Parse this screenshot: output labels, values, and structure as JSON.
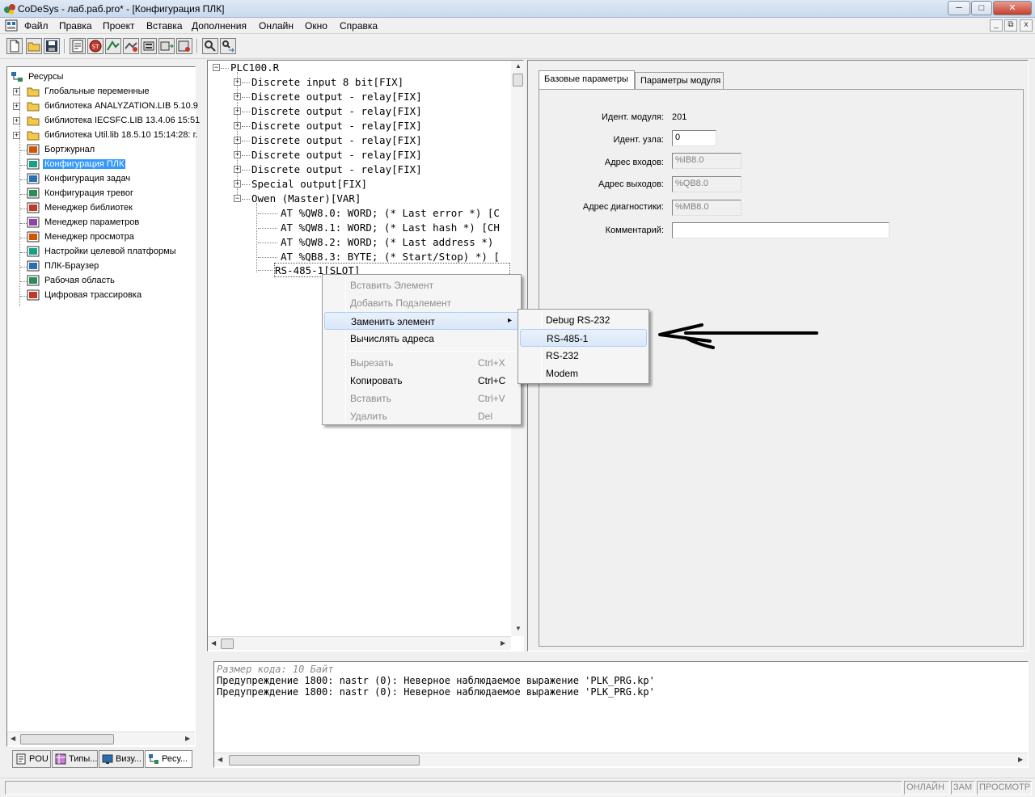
{
  "window": {
    "title": "CoDeSys - лаб.раб.pro* - [Конфигурация ПЛК]",
    "minimize": "─",
    "maximize": "□",
    "close": "✕"
  },
  "menu": {
    "items": [
      "Файл",
      "Правка",
      "Проект",
      "Вставка",
      "Дополнения",
      "Онлайн",
      "Окно",
      "Справка"
    ],
    "mdi_min": "_",
    "mdi_restore": "⧉",
    "mdi_close": "x"
  },
  "toolbar": {
    "icons": [
      "new-file-icon",
      "open-folder-icon",
      "save-icon",
      "compile-icon",
      "stop-icon",
      "login-icon",
      "logout-icon",
      "run-icon",
      "step-icon",
      "breakpoint-icon",
      "find-icon",
      "replace-icon"
    ]
  },
  "resources": {
    "root": "Ресурсы",
    "items": [
      {
        "label": "Глобальные переменные",
        "icon": "folder-icon",
        "expandable": true
      },
      {
        "label": "библиотека ANALYZATION.LIB 5.10.9",
        "icon": "folder-icon",
        "expandable": true
      },
      {
        "label": "библиотека IECSFC.LIB 13.4.06 15:51",
        "icon": "folder-icon",
        "expandable": true
      },
      {
        "label": "библиотека Util.lib 18.5.10 15:14:28: г.",
        "icon": "folder-icon",
        "expandable": true
      },
      {
        "label": "Бортжурнал",
        "icon": "logbook-icon",
        "expandable": false
      },
      {
        "label": "Конфигурация ПЛК",
        "icon": "plc-config-icon",
        "expandable": false,
        "selected": true
      },
      {
        "label": "Конфигурация задач",
        "icon": "task-config-icon",
        "expandable": false
      },
      {
        "label": "Конфигурация тревог",
        "icon": "alarm-config-icon",
        "expandable": false
      },
      {
        "label": "Менеджер библиотек",
        "icon": "library-manager-icon",
        "expandable": false
      },
      {
        "label": "Менеджер параметров",
        "icon": "parameter-manager-icon",
        "expandable": false
      },
      {
        "label": "Менеджер просмотра",
        "icon": "watch-manager-icon",
        "expandable": false
      },
      {
        "label": "Настройки целевой платформы",
        "icon": "target-settings-icon",
        "expandable": false
      },
      {
        "label": "ПЛК-Браузер",
        "icon": "plc-browser-icon",
        "expandable": false
      },
      {
        "label": "Рабочая область",
        "icon": "workspace-icon",
        "expandable": false
      },
      {
        "label": "Цифровая трассировка",
        "icon": "trace-icon",
        "expandable": false
      }
    ]
  },
  "bottom_tabs": [
    {
      "label": "POU",
      "icon": "pou-icon"
    },
    {
      "label": "Типы...",
      "icon": "types-icon"
    },
    {
      "label": "Визу...",
      "icon": "visualization-icon"
    },
    {
      "label": "Ресу...",
      "icon": "resources-icon"
    }
  ],
  "config_tree": {
    "root": "PLC100.R",
    "nodes": [
      {
        "text": "Discrete input 8 bit[FIX]",
        "sign": "+"
      },
      {
        "text": "Discrete output - relay[FIX]",
        "sign": "+"
      },
      {
        "text": "Discrete output - relay[FIX]",
        "sign": "+"
      },
      {
        "text": "Discrete output - relay[FIX]",
        "sign": "+"
      },
      {
        "text": "Discrete output - relay[FIX]",
        "sign": "+"
      },
      {
        "text": "Discrete output - relay[FIX]",
        "sign": "+"
      },
      {
        "text": "Discrete output - relay[FIX]",
        "sign": "+"
      },
      {
        "text": "Special output[FIX]",
        "sign": "+"
      },
      {
        "text": "Owen (Master)[VAR]",
        "sign": "−"
      }
    ],
    "children": [
      "AT %QW8.0: WORD; (* Last error *) [C",
      "AT %QW8.1: WORD; (* Last hash *) [CH",
      "AT %QW8.2: WORD; (* Last address *)",
      "AT %QB8.3: BYTE; (* Start/Stop) *) ["
    ],
    "slot": "RS-485-1[SLOT]"
  },
  "props": {
    "tabs": [
      "Базовые параметры",
      "Параметры модуля"
    ],
    "module_id_label": "Идент. модуля:",
    "module_id_value": "201",
    "node_id_label": "Идент. узла:",
    "node_id_value": "0",
    "input_addr_label": "Адрес входов:",
    "input_addr_value": "%IB8.0",
    "output_addr_label": "Адрес выходов:",
    "output_addr_value": "%QB8.0",
    "diag_addr_label": "Адрес диагностики:",
    "diag_addr_value": "%MB8.0",
    "comment_label": "Комментарий:",
    "comment_value": ""
  },
  "messages": [
    {
      "text": "Размер кода: 10 Байт",
      "dim": true
    },
    {
      "text": "Предупреждение 1800: nastr (0): Неверное наблюдаемое выражение 'PLK_PRG.kp'",
      "dim": false
    },
    {
      "text": "Предупреждение 1800: nastr (0): Неверное наблюдаемое выражение 'PLK_PRG.kp'",
      "dim": false
    }
  ],
  "status": [
    "ОНЛАЙН",
    "ЗАМ",
    "ПРОСМОТР"
  ],
  "context_menu": {
    "items": [
      {
        "label": "Вставить Элемент",
        "shortcut": "",
        "disabled": true
      },
      {
        "label": "Добавить Подэлемент",
        "shortcut": "",
        "disabled": true
      },
      {
        "label": "Заменить элемент",
        "shortcut": "",
        "disabled": false,
        "submenu": true,
        "highlighted": true
      },
      {
        "label": "Вычислять адреса",
        "shortcut": "",
        "disabled": false
      },
      {
        "separator": true
      },
      {
        "label": "Вырезать",
        "shortcut": "Ctrl+X",
        "disabled": true
      },
      {
        "label": "Копировать",
        "shortcut": "Ctrl+C",
        "disabled": false
      },
      {
        "label": "Вставить",
        "shortcut": "Ctrl+V",
        "disabled": true
      },
      {
        "label": "Удалить",
        "shortcut": "Del",
        "disabled": true
      }
    ],
    "submenu_arrow": "▸"
  },
  "submenu": {
    "items": [
      {
        "label": "Debug RS-232",
        "highlighted": false
      },
      {
        "label": "RS-485-1",
        "highlighted": true
      },
      {
        "label": "RS-232",
        "highlighted": false
      },
      {
        "label": "Modem",
        "highlighted": false
      }
    ]
  },
  "colors": {
    "selection": "#3399ff",
    "menu_highlight": "#d9e7f8",
    "disabled_text": "#8d8d8d"
  }
}
